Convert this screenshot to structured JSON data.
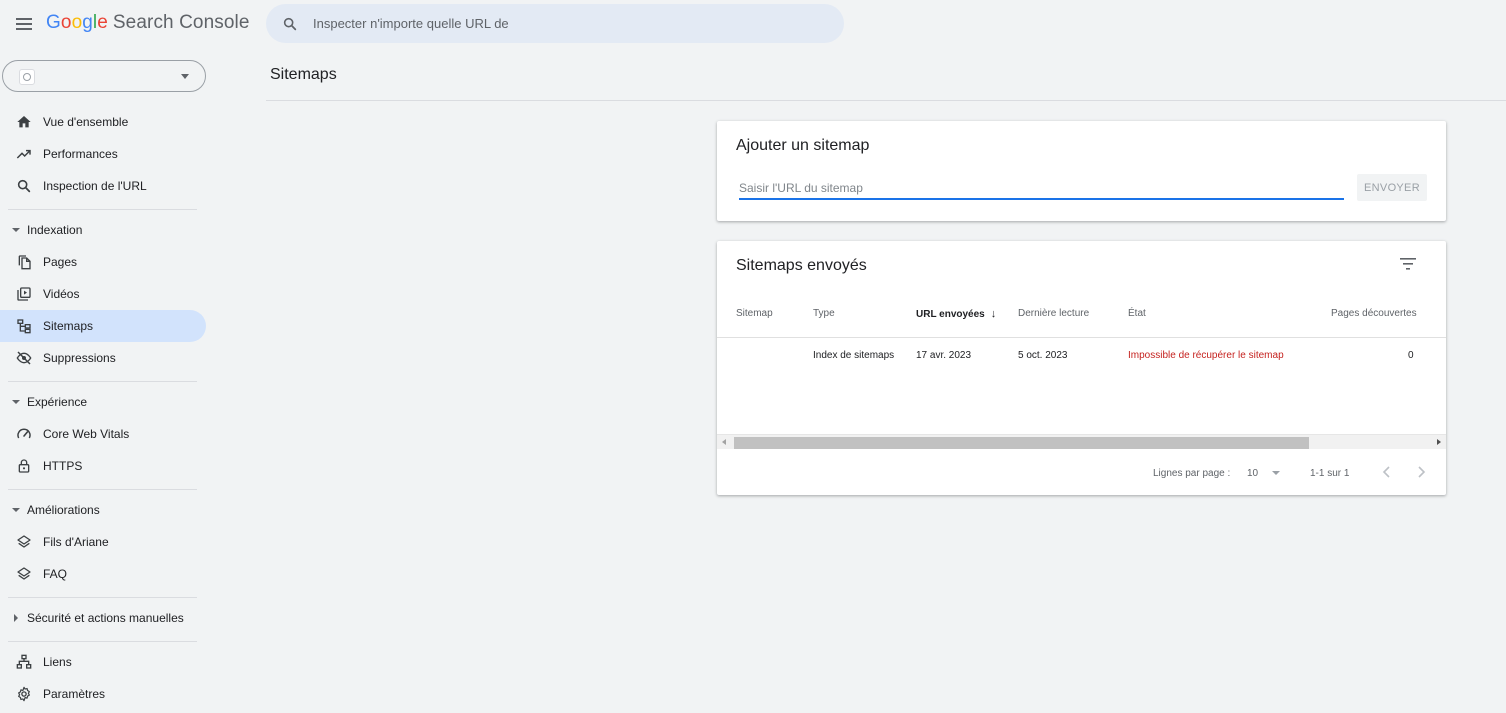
{
  "app": {
    "logo_letters": [
      "G",
      "o",
      "o",
      "g",
      "l",
      "e"
    ],
    "logo_rest": "Search Console"
  },
  "search": {
    "placeholder": "Inspecter n'importe quelle URL de"
  },
  "sidebar": {
    "items": [
      {
        "label": "Vue d'ensemble",
        "icon": "home-icon"
      },
      {
        "label": "Performances",
        "icon": "trending-up-icon"
      },
      {
        "label": "Inspection de l'URL",
        "icon": "search-icon"
      }
    ],
    "sections": {
      "indexation": "Indexation",
      "experience": "Expérience",
      "ameliorations": "Améliorations",
      "securite": "Sécurité et actions manuelles"
    },
    "indexation_items": [
      {
        "label": "Pages",
        "icon": "pages-icon"
      },
      {
        "label": "Vidéos",
        "icon": "video-icon"
      },
      {
        "label": "Sitemaps",
        "icon": "sitemap-icon",
        "active": true
      },
      {
        "label": "Suppressions",
        "icon": "eye-off-icon"
      }
    ],
    "experience_items": [
      {
        "label": "Core Web Vitals",
        "icon": "gauge-icon"
      },
      {
        "label": "HTTPS",
        "icon": "lock-icon"
      }
    ],
    "ameliorations_items": [
      {
        "label": "Fils d'Ariane",
        "icon": "layers-icon"
      },
      {
        "label": "FAQ",
        "icon": "layers-icon"
      }
    ],
    "bottom_items": [
      {
        "label": "Liens",
        "icon": "links-icon"
      },
      {
        "label": "Paramètres",
        "icon": "gear-icon"
      }
    ]
  },
  "page": {
    "title": "Sitemaps"
  },
  "add_sitemap": {
    "title": "Ajouter un sitemap",
    "placeholder": "Saisir l'URL du sitemap",
    "value": "",
    "submit_label": "ENVOYER"
  },
  "submitted": {
    "title": "Sitemaps envoyés",
    "columns": {
      "sitemap": "Sitemap",
      "type": "Type",
      "urls_sent": "URL envoyées",
      "last_read": "Dernière lecture",
      "status": "État",
      "pages_found": "Pages découvertes"
    },
    "sort_arrow": "↓",
    "rows": [
      {
        "sitemap": "",
        "type": "Index de sitemaps",
        "urls_sent": "17 avr. 2023",
        "last_read": "5 oct. 2023",
        "status": "Impossible de récupérer le sitemap",
        "pages_found": "0"
      }
    ],
    "pagination": {
      "rows_per_page_label": "Lignes par page :",
      "rows_per_page": "10",
      "range": "1-1 sur 1"
    }
  },
  "colors": {
    "accent": "#1a73e8",
    "active_nav_bg": "#d2e3fc",
    "error": "#c5221f",
    "background": "#f1f3f4"
  }
}
